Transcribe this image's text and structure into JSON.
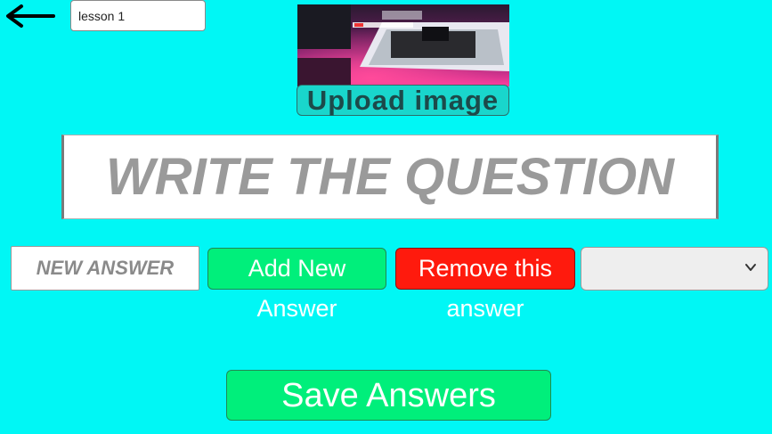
{
  "header": {
    "back_icon": "arrow-left-icon",
    "lesson_value": "lesson 1"
  },
  "image_upload": {
    "preview_alt": "uploaded-image-preview",
    "button_label": "Upload image"
  },
  "question": {
    "placeholder": "WRITE THE QUESTION"
  },
  "answers": {
    "new_answer_placeholder": "NEW ANSWER",
    "add_label": "Add New Answer",
    "remove_label": "Remove this answer",
    "select_value": "",
    "select_icon": "chevron-down-icon"
  },
  "footer": {
    "save_label": "Save Answers"
  },
  "colors": {
    "background": "#00f7f5",
    "green_button": "#00ef7b",
    "red_button": "#ff1a0d",
    "upload_button": "#19d6cc"
  }
}
